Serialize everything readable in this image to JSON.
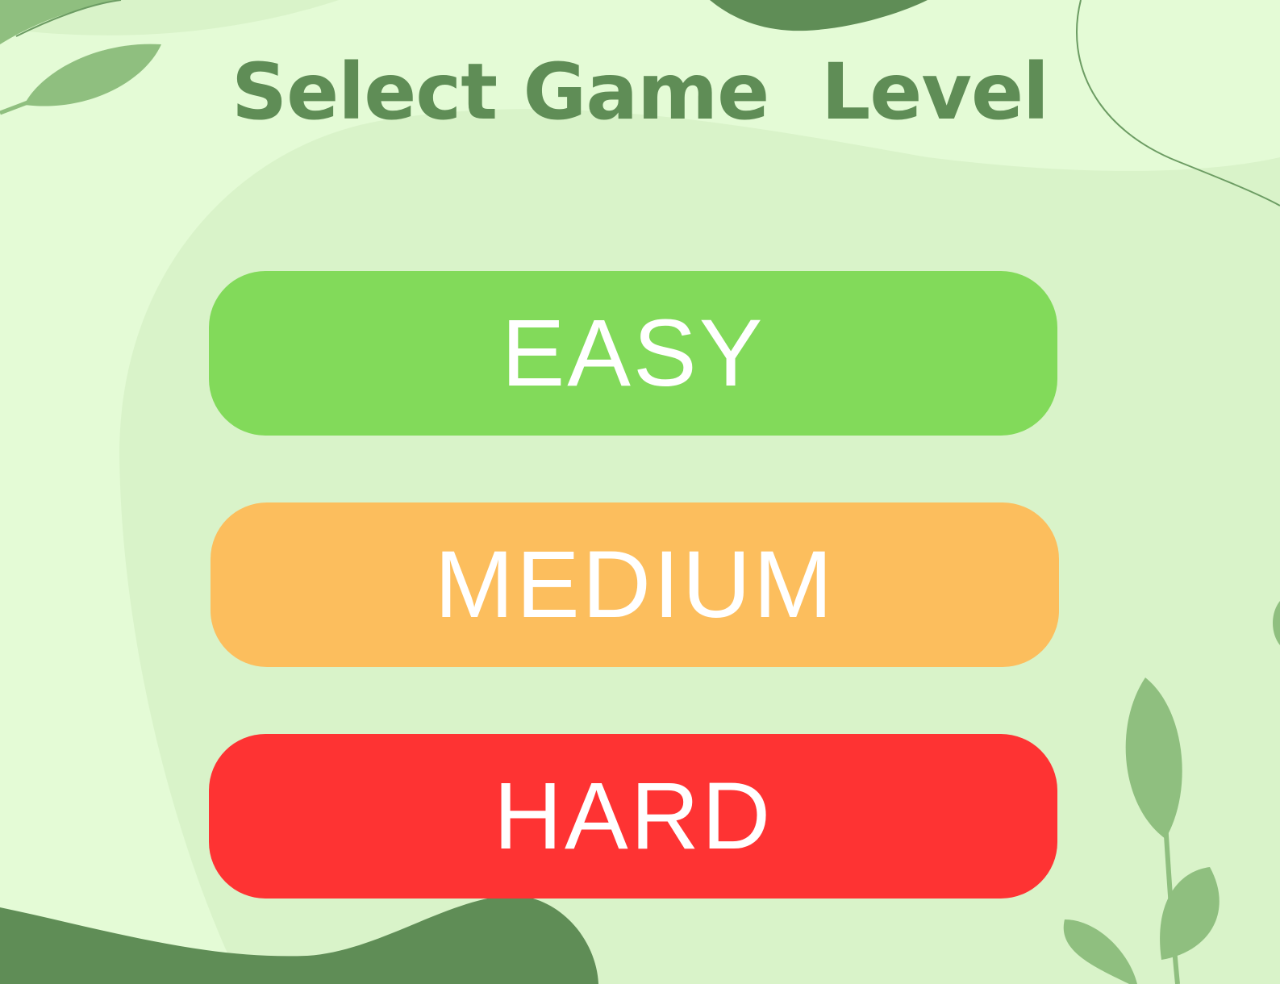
{
  "screen": {
    "title": "Select Game  Level"
  },
  "levels": [
    {
      "id": "easy",
      "label": "EASY",
      "color": "#82da5a"
    },
    {
      "id": "medium",
      "label": "MEDIUM",
      "color": "#fcbe5d"
    },
    {
      "id": "hard",
      "label": "HARD",
      "color": "#fe3333"
    }
  ],
  "theme": {
    "background": "#e4fbd6",
    "blob": "#d9f3c9",
    "accent_dark_green": "#5f8d56",
    "leaf_green": "#8fbf7f",
    "button_text": "#ffffff"
  },
  "decorations": [
    "leaf-branch-icon",
    "leaf-sprig-icon",
    "green-blob-shape",
    "curve-line-shape"
  ]
}
